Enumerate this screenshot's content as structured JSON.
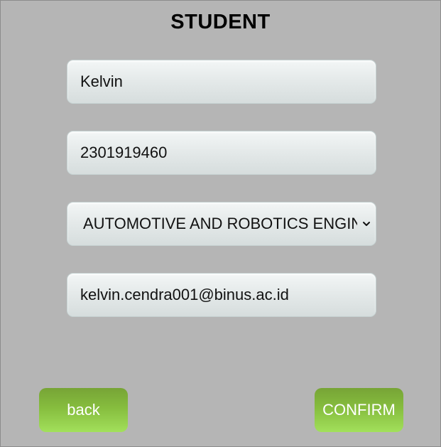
{
  "form": {
    "title": "STUDENT",
    "name_value": "Kelvin",
    "nim_value": "2301919460",
    "major_selected": "AUTOMOTIVE AND ROBOTICS ENGINEERING",
    "email_value": "kelvin.cendra001@binus.ac.id"
  },
  "buttons": {
    "back_label": "back",
    "confirm_label": "CONFIRM"
  },
  "colors": {
    "background": "#b5b5b5",
    "button_green": "#86bd3e",
    "field_bg": "#e5eaea"
  },
  "icons": {
    "select_arrow": "chevron-down-icon"
  }
}
